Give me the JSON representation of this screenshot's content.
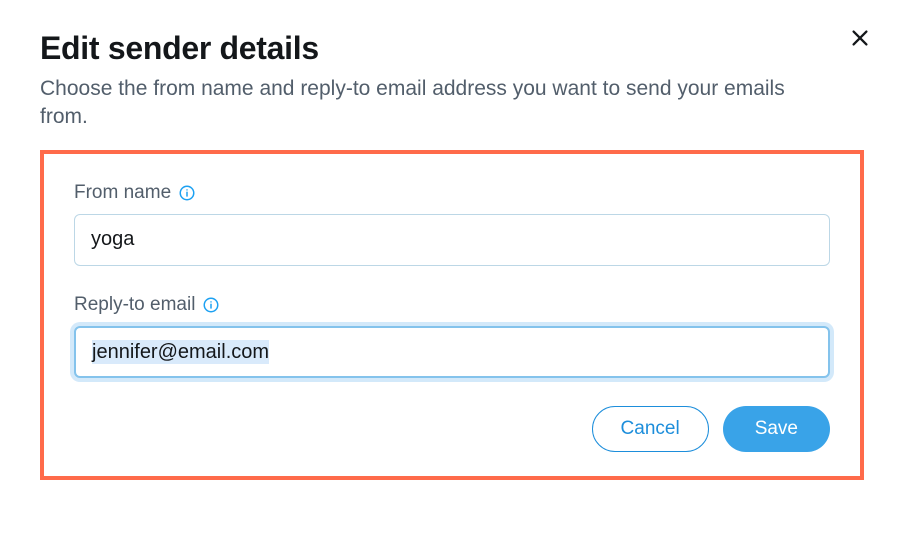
{
  "modal": {
    "title": "Edit sender details",
    "subtitle": "Choose the from name and reply-to email address you want to send your emails from."
  },
  "fields": {
    "from_name": {
      "label": "From name",
      "value": "yoga"
    },
    "reply_to": {
      "label": "Reply-to email",
      "value": "jennifer@email.com"
    }
  },
  "buttons": {
    "cancel": "Cancel",
    "save": "Save"
  }
}
